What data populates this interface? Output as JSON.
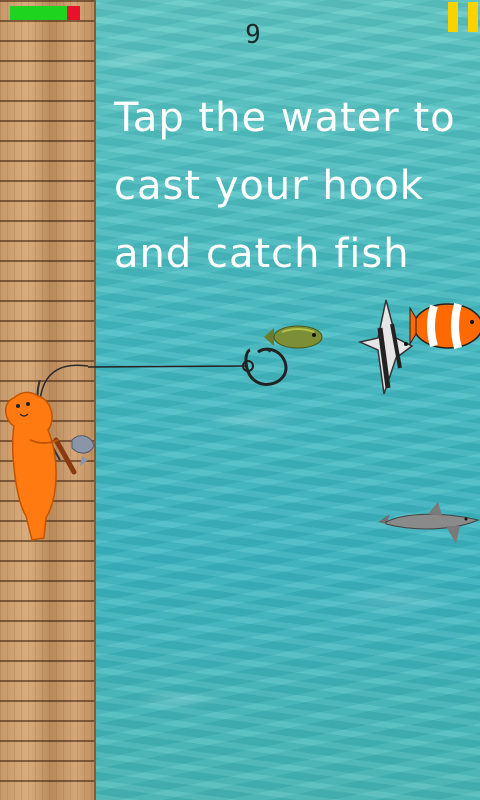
{
  "game": {
    "score": "9",
    "instruction": "Tap the water to cast your hook and catch fish",
    "health_fraction": 0.81
  },
  "colors": {
    "health_full": "#1fd41f",
    "health_empty": "#e8102a",
    "pause": "#f7d400",
    "text": "#ffffff"
  },
  "sprites": [
    "seal-fisher",
    "fishing-rod",
    "fishing-line",
    "hook",
    "green-fish",
    "angelfish",
    "clownfish",
    "shark",
    "caught-fish"
  ]
}
